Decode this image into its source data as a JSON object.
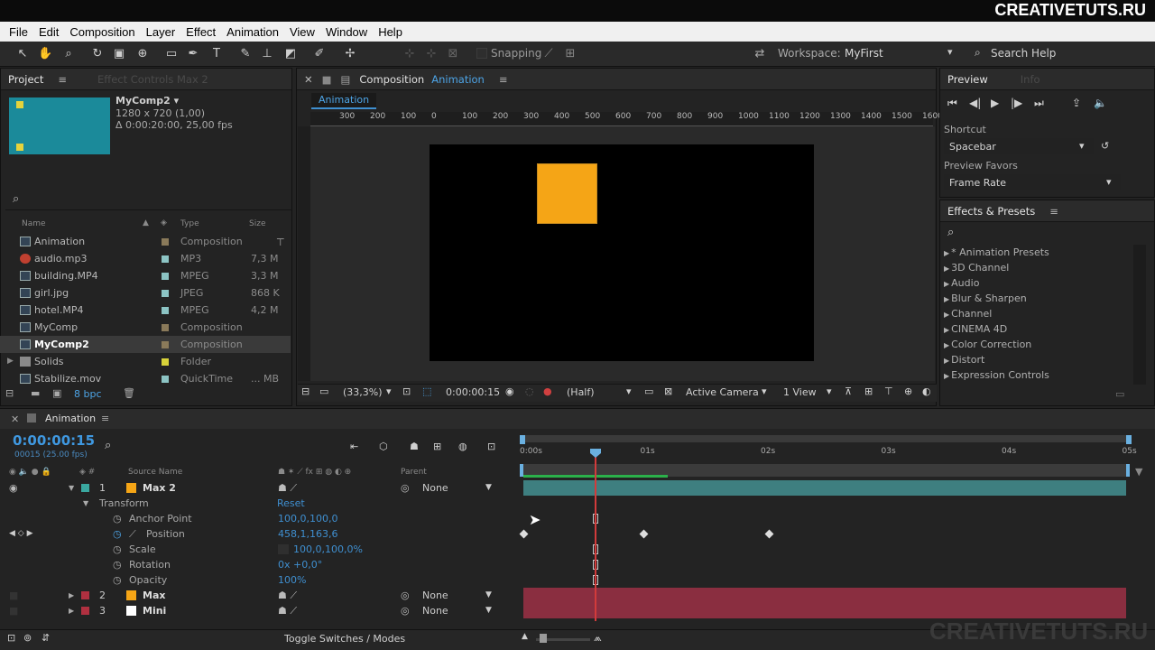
{
  "brand": "CREATIVETUTS.RU",
  "watermark": "CREATIVETUTS.RU",
  "menu": [
    "File",
    "Edit",
    "Composition",
    "Layer",
    "Effect",
    "Animation",
    "View",
    "Window",
    "Help"
  ],
  "toolbar": {
    "snapping": "Snapping",
    "workspace_label": "Workspace:",
    "workspace_value": "MyFirst",
    "search_help": "Search Help"
  },
  "project": {
    "tab_project": "Project",
    "tab_effect_controls": "Effect Controls Max 2",
    "comp_name": "MyComp2 ▾",
    "comp_res": "1280 x 720 (1,00)",
    "comp_dur": "Δ 0:00:20:00, 25,00 fps",
    "col_name": "Name",
    "col_type": "Type",
    "col_size": "Size",
    "items": [
      {
        "name": "Animation",
        "type": "Composition",
        "size": "",
        "color": "#8a7a5a"
      },
      {
        "name": "audio.mp3",
        "type": "MP3",
        "size": "7,3 M",
        "color": "#8cc4c4"
      },
      {
        "name": "building.MP4",
        "type": "MPEG",
        "size": "3,3 M",
        "color": "#8cc4c4"
      },
      {
        "name": "girl.jpg",
        "type": "JPEG",
        "size": "868 K",
        "color": "#8cc4c4"
      },
      {
        "name": "hotel.MP4",
        "type": "MPEG",
        "size": "4,2 M",
        "color": "#8cc4c4"
      },
      {
        "name": "MyComp",
        "type": "Composition",
        "size": "",
        "color": "#8a7a5a"
      },
      {
        "name": "MyComp2",
        "type": "Composition",
        "size": "",
        "color": "#8a7a5a"
      },
      {
        "name": "Solids",
        "type": "Folder",
        "size": "",
        "color": "#d8d23a"
      },
      {
        "name": "Stabilize.mov",
        "type": "QuickTime",
        "size": "... MB",
        "color": "#8cc4c4"
      }
    ],
    "bpc": "8 bpc"
  },
  "composition": {
    "tab_title": "Composition",
    "tab_name": "Animation",
    "subtab": "Animation",
    "ruler": [
      "300",
      "200",
      "100",
      "0",
      "100",
      "200",
      "300",
      "400",
      "500",
      "600",
      "700",
      "800",
      "900",
      "1000",
      "1100",
      "1200",
      "1300",
      "1400",
      "1500",
      "1600"
    ],
    "zoom": "(33,3%)",
    "timecode": "0:00:00:15",
    "resolution": "(Half)",
    "camera": "Active Camera",
    "view": "1 View"
  },
  "preview": {
    "tab_preview": "Preview",
    "tab_info": "Info",
    "shortcut_label": "Shortcut",
    "shortcut_value": "Spacebar",
    "favors_label": "Preview Favors",
    "favors_value": "Frame Rate"
  },
  "effects": {
    "title": "Effects & Presets",
    "items": [
      "* Animation Presets",
      "3D Channel",
      "Audio",
      "Blur & Sharpen",
      "Channel",
      "CINEMA 4D",
      "Color Correction",
      "Distort",
      "Expression Controls"
    ]
  },
  "timeline": {
    "tab": "Animation",
    "timecode": "0:00:00:15",
    "frames": "00015 (25.00 fps)",
    "ticks": [
      "0:00s",
      "01s",
      "02s",
      "03s",
      "04s",
      "05s"
    ],
    "col_source": "Source Name",
    "col_parent": "Parent",
    "layers": [
      {
        "num": "1",
        "name": "Max 2",
        "color": "#f5a516",
        "label": "#3aa8a0",
        "parent": "None"
      },
      {
        "num": "2",
        "name": "Max",
        "color": "#f5a516",
        "label": "#b03040",
        "parent": "None"
      },
      {
        "num": "3",
        "name": "Mini",
        "color": "#ffffff",
        "label": "#b03040",
        "parent": "None"
      }
    ],
    "transform": "Transform",
    "reset": "Reset",
    "props": [
      {
        "name": "Anchor Point",
        "value": "100,0,100,0"
      },
      {
        "name": "Position",
        "value": "458,1,163,6"
      },
      {
        "name": "Scale",
        "value": "100,0,100,0%"
      },
      {
        "name": "Rotation",
        "value": "0x +0,0°"
      },
      {
        "name": "Opacity",
        "value": "100%"
      }
    ],
    "toggle": "Toggle Switches / Modes"
  }
}
